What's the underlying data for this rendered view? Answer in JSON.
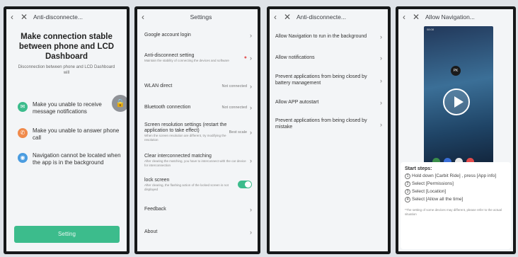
{
  "panel1": {
    "title": "Anti-disconnecte...",
    "heading": "Make connection stable between phone and LCD Dashboard",
    "subtitle": "Disconnection between phone and LCD Dashboard will",
    "warnings": [
      {
        "text": "Make you unable to receive message notifications",
        "color": "#3cbc8c",
        "icon": "message-icon",
        "glyph": "✉"
      },
      {
        "text": "Make you unable to answer phone call",
        "color": "#f08a4b",
        "icon": "phone-icon",
        "glyph": "✆"
      },
      {
        "text": "Navigation cannot be located when the app is in the background",
        "color": "#4a9ce0",
        "icon": "location-icon",
        "glyph": "◉"
      }
    ],
    "button": "Setting"
  },
  "panel2": {
    "title": "Settings",
    "rows": [
      {
        "label": "Google account login",
        "desc": "",
        "value": ""
      },
      {
        "label": "Anti-disconnect setting",
        "desc": "Maintain the stability of connecting the devices and software",
        "value": ""
      },
      {
        "label": "WLAN direct",
        "desc": "",
        "value": "Not connected"
      },
      {
        "label": "Bluetooth connection",
        "desc": "",
        "value": "Not connected"
      },
      {
        "label": "Screen resolution settings (restart the application to take effect)",
        "desc": "When the screen resolution are different, try modifying the resolution",
        "value": "Best scale"
      },
      {
        "label": "Clear interconnected matching",
        "desc": "After clearing the matching, you have to interconnect with the car device for interconnection",
        "value": ""
      },
      {
        "label": "lock screen",
        "desc": "After clearing, the flashing action of the locked screen is not displayed",
        "value": ""
      },
      {
        "label": "Feedback",
        "desc": "",
        "value": ""
      },
      {
        "label": "About",
        "desc": "",
        "value": ""
      }
    ]
  },
  "panel3": {
    "title": "Anti-disconnecte...",
    "rows": [
      "Allow Navigation to run in the background",
      "Allow notifications",
      "Prevent applications from being closed by battery management",
      "Allow APP autostart",
      "Prevent applications from being closed by mistake"
    ]
  },
  "panel4": {
    "title": "Allow Navigation...",
    "status": "08:08",
    "avatar": "PK",
    "steps_title": "Start steps:",
    "steps": [
      {
        "num": "1",
        "text": "Hold down [Carbit Ride] , press [App info]"
      },
      {
        "num": "2",
        "text": "Select [Permissions]"
      },
      {
        "num": "3",
        "text": "Select [Location]"
      },
      {
        "num": "4",
        "text": "Select [Allow all the time]"
      }
    ],
    "note": "*The setting of some devices may different, please refer to the actual situation",
    "dock_colors": [
      "#3a8d4a",
      "#3a6fd8",
      "#e7e7e7",
      "#e24b4b"
    ]
  }
}
